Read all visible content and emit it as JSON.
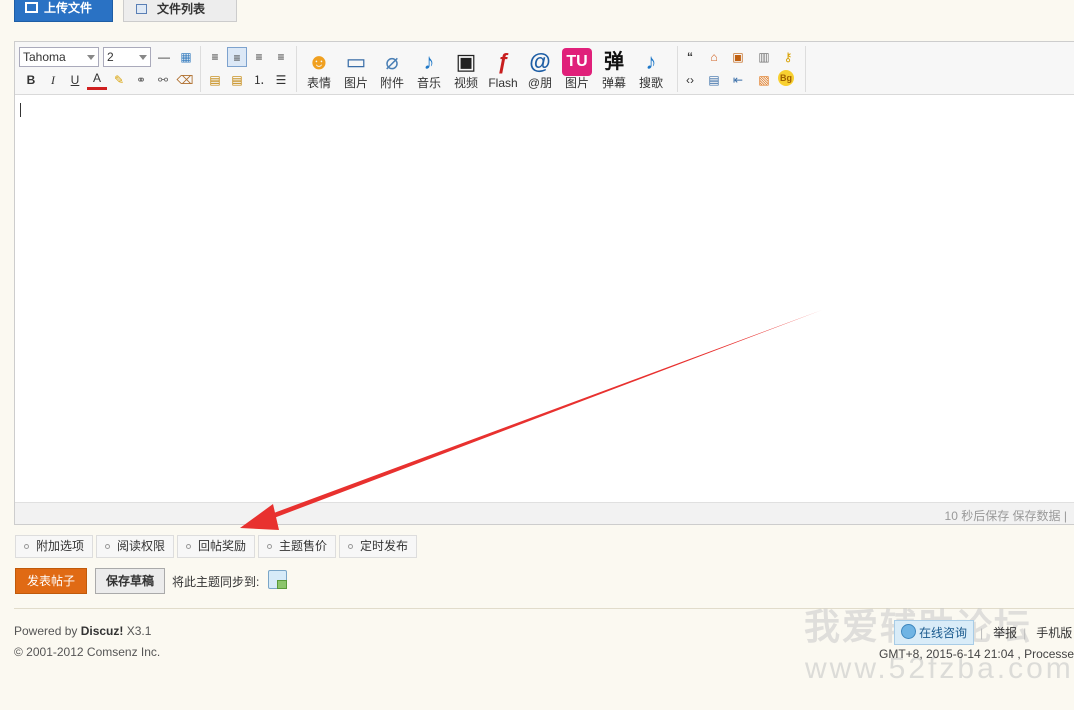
{
  "tabs": {
    "upload": "上传文件",
    "filelist": "文件列表"
  },
  "toolbar": {
    "font_family": "Tahoma",
    "font_size": "2",
    "format_buttons": [
      "B",
      "I",
      "U",
      "A"
    ],
    "media": [
      {
        "label": "表情",
        "icon": "smiley-icon",
        "glyph": "☻",
        "color": "#f0a020"
      },
      {
        "label": "图片",
        "icon": "image-icon",
        "glyph": "▭",
        "color": "#3a6ea8"
      },
      {
        "label": "附件",
        "icon": "paperclip-icon",
        "glyph": "⌀",
        "color": "#4a7fb5"
      },
      {
        "label": "音乐",
        "icon": "music-note-icon",
        "glyph": "♪",
        "color": "#1e78c8"
      },
      {
        "label": "视频",
        "icon": "film-icon",
        "glyph": "▣",
        "color": "#222222"
      },
      {
        "label": "Flash",
        "icon": "flash-icon",
        "glyph": "ƒ",
        "color": "#c81e1e"
      },
      {
        "label": "@朋",
        "icon": "at-icon",
        "glyph": "@",
        "color": "#1e5ea5"
      },
      {
        "label": "图片",
        "icon": "tu-icon",
        "glyph": "TU",
        "color": "#e0207a"
      },
      {
        "label": "弹幕",
        "icon": "danmaku-icon",
        "glyph": "弹",
        "color": "#111111"
      },
      {
        "label": "搜歌",
        "icon": "search-song-icon",
        "glyph": "♪",
        "color": "#1e78c8"
      }
    ]
  },
  "editor": {
    "autosave": "10 秒后保存 保存数据 |"
  },
  "options": [
    "附加选项",
    "阅读权限",
    "回帖奖励",
    "主题售价",
    "定时发布"
  ],
  "actions": {
    "post": "发表帖子",
    "draft": "保存草稿",
    "sync": "将此主题同步到:"
  },
  "footer": {
    "powered_prefix": "Powered by ",
    "powered_brand": "Discuz!",
    "powered_version": " X3.1",
    "copyright": "© 2001-2012 Comsenz Inc.",
    "consult": "在线咨询",
    "report": "举报",
    "mobile": "手机版",
    "time": "GMT+8, 2015-6-14 21:04 , Processe"
  },
  "watermark": {
    "text": "我爱辅助论坛",
    "url": "www.52fzba.com"
  },
  "colors": {
    "accent_blue": "#2a72c4",
    "post_orange": "#e06a14",
    "arrow_red": "#e8312f"
  }
}
